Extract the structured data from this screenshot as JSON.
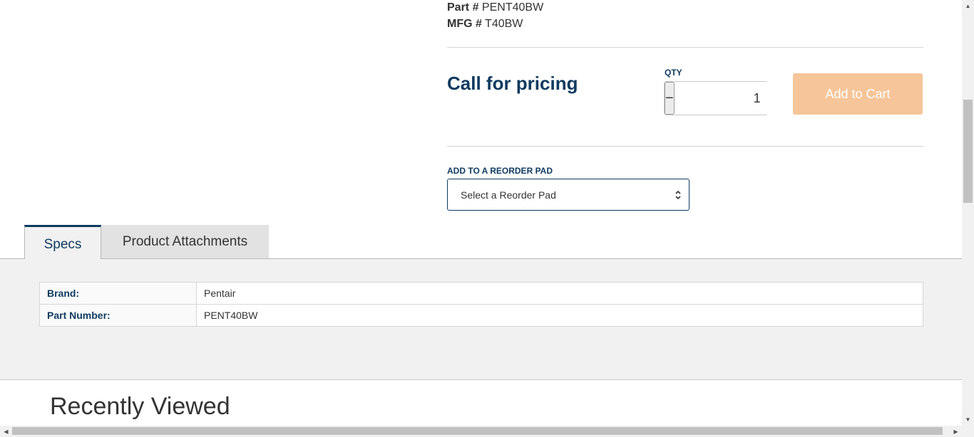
{
  "product": {
    "part_label": "Part #",
    "part_value": "PENT40BW",
    "mfg_label": "MFG #",
    "mfg_value": "T40BW",
    "price_text": "Call for pricing"
  },
  "quantity": {
    "label": "QTY",
    "value": "1",
    "decrement_symbol": "−",
    "increment_symbol": "+"
  },
  "cart": {
    "add_label": "Add to Cart",
    "button_color": "#f6c599"
  },
  "reorder": {
    "label": "ADD TO A REORDER PAD",
    "selected": "Select a Reorder Pad"
  },
  "tabs": [
    {
      "label": "Specs",
      "active": true
    },
    {
      "label": "Product Attachments",
      "active": false
    }
  ],
  "specs": [
    {
      "key": "Brand:",
      "value": "Pentair"
    },
    {
      "key": "Part Number:",
      "value": "PENT40BW"
    }
  ],
  "recently_viewed": {
    "title": "Recently Viewed"
  },
  "colors": {
    "accent": "#0e3a5f"
  }
}
